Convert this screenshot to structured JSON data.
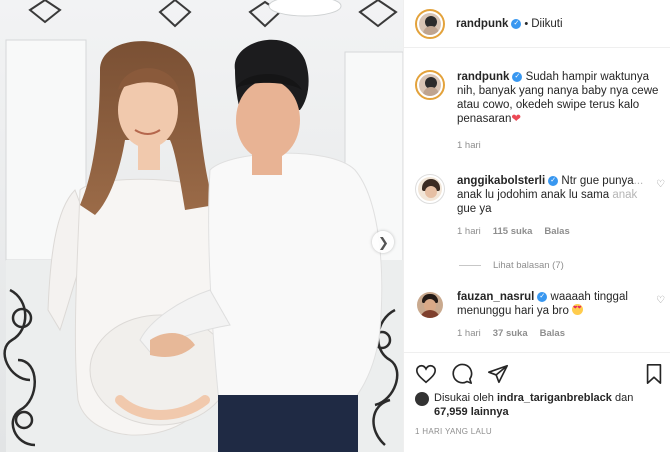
{
  "post": {
    "author": "randpunk",
    "separator": "•",
    "follow_status": "Diikuti",
    "caption": "Sudah hampir waktunya nih, banyak yang nanya baby nya cewe atau cowo, okedeh swipe terus kalo penasaran",
    "caption_time": "1 hari"
  },
  "comments": [
    {
      "username": "anggikabolsterli",
      "text_main": "Ntr gue punya",
      "text_tail": "...",
      "text_line2_main": "anak lu jodohim anak lu sama ",
      "text_line2_fade": "anak",
      "text_line3": "gue ya",
      "time": "1 hari",
      "likes": "115 suka",
      "reply": "Balas",
      "view_replies": "Lihat balasan (7)"
    },
    {
      "username": "fauzan_nasrul",
      "text": "waaaah tinggal menunggu hari ya bro",
      "time": "1 hari",
      "likes": "37 suka",
      "reply": "Balas"
    }
  ],
  "liked_by": {
    "prefix": "Disukai oleh",
    "user": "indra_tariganbreblack",
    "connector": "dan",
    "count": "67,959 lainnya"
  },
  "posted_ago": "1 HARI YANG LALU",
  "icons": {
    "verified": "verified-badge-icon",
    "like": "heart-icon",
    "comment": "comment-icon",
    "share": "paper-plane-icon",
    "save": "bookmark-icon",
    "next": "chevron-right-icon"
  },
  "colors": {
    "verified": "#3897f0",
    "heart": "#ed4956",
    "muted": "#8e8e8e",
    "text": "#262626"
  }
}
